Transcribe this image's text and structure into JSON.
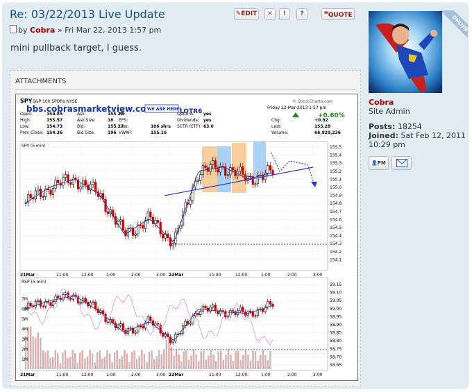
{
  "post": {
    "title": "Re: 03/22/2013 Live Update",
    "by_label": "by",
    "author": "Cobra",
    "date": "» Fri Mar 22, 2013 1:57 pm",
    "body": "mini pullback target, I guess.",
    "attachments_label": "ATTACHMENTS",
    "buttons": {
      "edit": "EDIT",
      "delete": "✕",
      "report": "!",
      "info": "?",
      "quote": "QUOTE"
    }
  },
  "profile": {
    "online_badge": "ONLINE",
    "name": "Cobra",
    "rank": "Site Admin",
    "posts_label": "Posts:",
    "posts": "18254",
    "joined_label": "Joined:",
    "joined": "Sat Feb 12, 2011 10:29 pm",
    "pm_button": "PM"
  },
  "chart": {
    "symbol": "SPY",
    "name": "S&P 500 SPDRs NYSE",
    "source": "© StockCharts.com",
    "url": "bbs.cobrasmarketview.com",
    "badge": "WE ARE HERE!",
    "overlay_tail": "LOTR6",
    "date_line": "Friday   22-Mar-2013  1:57 pm",
    "pct_change": "+0.60%",
    "fields": [
      [
        "Open:",
        "154.85"
      ],
      [
        "High:",
        "155.57"
      ],
      [
        "Low:",
        "154.73"
      ],
      [
        "Prev Close:",
        "154.36"
      ],
      [
        "Ask:",
        "155.28"
      ],
      [
        "Ask Size:",
        "18"
      ],
      [
        "Bid:",
        "155.27"
      ],
      [
        "Bid Size:",
        "196"
      ],
      [
        "P/E:",
        ""
      ],
      [
        "EPS:",
        ""
      ],
      [
        "Last:",
        "106 shrs"
      ],
      [
        "VWAP:",
        "155.16"
      ],
      [
        "Options:",
        "yes"
      ],
      [
        "Dividends:",
        "yes"
      ],
      [
        "SCTR (ETF):",
        "63.0"
      ],
      [
        "Chg:",
        "+0.92"
      ],
      [
        "Last:",
        "155.28"
      ],
      [
        "Volume:",
        "66,929,236"
      ]
    ],
    "top_panel_label": "SPY (5 min)",
    "bottom_panel_label": "RSP (5 min)",
    "top_price_ticks": [
      "155.5",
      "155.4",
      "155.3",
      "155.2",
      "155.1",
      "155.0",
      "154.9",
      "154.8",
      "154.7",
      "154.6",
      "154.5",
      "154.4",
      "154.3",
      "154.2",
      "154.1"
    ],
    "bottom_price_ticks": [
      "59.15",
      "59.10",
      "59.05",
      "59.00",
      "58.95",
      "58.90",
      "58.85",
      "58.80",
      "58.75",
      "58.70",
      "58.65"
    ],
    "volume_ticks": [
      "7M",
      "6M",
      "5M",
      "4M",
      "3M",
      "2M",
      "1M"
    ],
    "time_labels": [
      "21Mar",
      "11:00",
      "12:00",
      "1:00",
      "2:00",
      "3:00",
      "22Mar",
      "11:00",
      "12:00",
      "1:00",
      "2:00",
      "3:00"
    ]
  },
  "chart_data": [
    {
      "type": "line",
      "title": "SPY (5 min)",
      "ylim": [
        154.1,
        155.6
      ],
      "series": [
        {
          "name": "SPY (5 min)",
          "x": [
            "21Mar",
            "11:00",
            "12:00",
            "1:00",
            "2:00",
            "3:00",
            "22Mar",
            "11:00",
            "12:00",
            "1:00",
            "2:00"
          ],
          "values": [
            154.9,
            155.1,
            155.2,
            155.0,
            154.5,
            154.7,
            154.4,
            155.3,
            155.35,
            155.2,
            155.28
          ]
        }
      ]
    },
    {
      "type": "line",
      "title": "RSP (5 min)",
      "ylim": [
        58.65,
        59.15
      ],
      "series": [
        {
          "name": "RSP (5 min)",
          "x": [
            "21Mar",
            "11:00",
            "12:00",
            "1:00",
            "2:00",
            "3:00",
            "22Mar",
            "11:00",
            "12:00",
            "1:00",
            "2:00"
          ],
          "values": [
            59.0,
            59.05,
            59.08,
            58.98,
            58.85,
            58.92,
            58.8,
            59.0,
            58.98,
            58.97,
            59.02
          ]
        }
      ]
    }
  ]
}
